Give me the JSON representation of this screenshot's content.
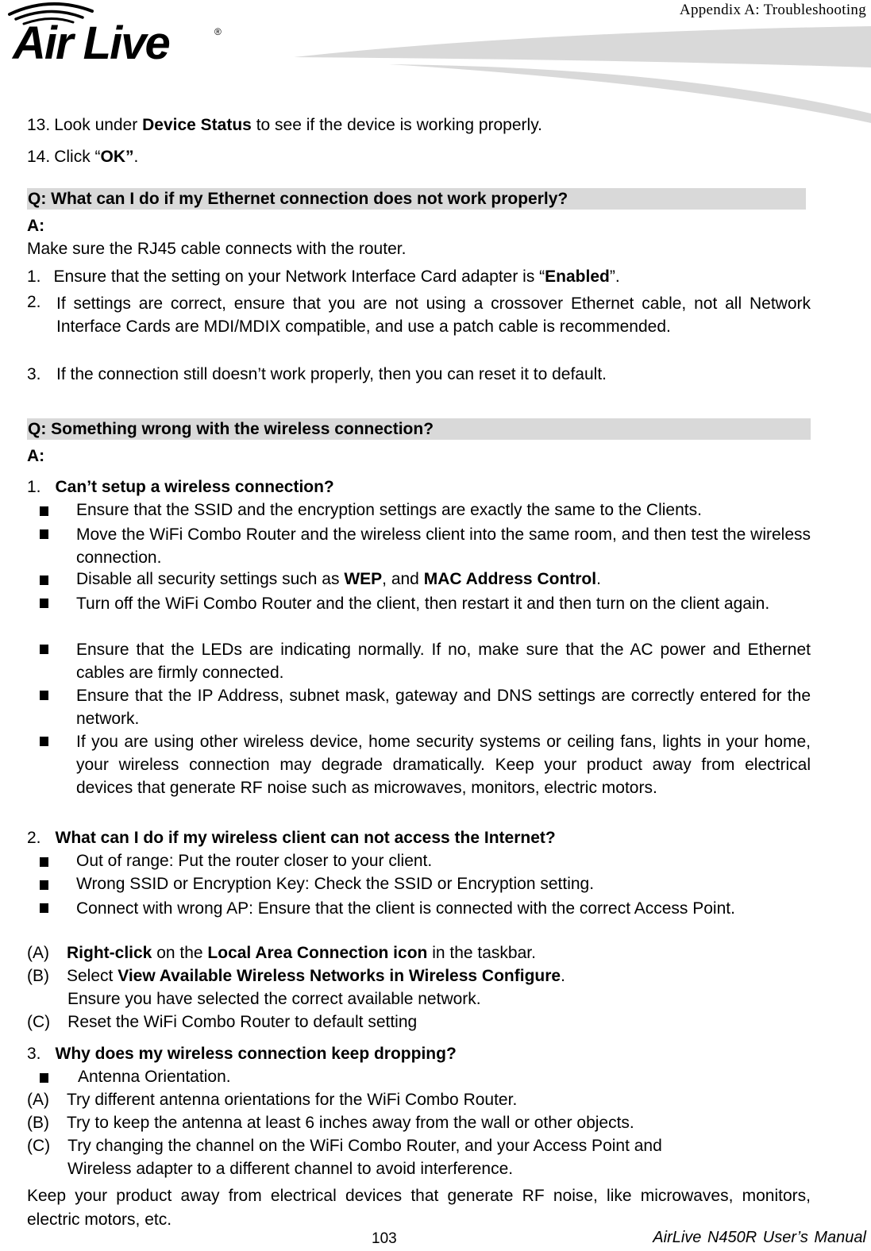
{
  "header": {
    "section_title": "Appendix  A:  Troubleshooting",
    "logo_text": "Air Live"
  },
  "steps": [
    {
      "num": "13.",
      "pre": "Look under ",
      "bold": "Device Status",
      "post": " to see if the device is working properly."
    },
    {
      "num": "14.",
      "pre": "Click “",
      "bold": "OK”",
      "post": "."
    }
  ],
  "q1": {
    "question": "Q: What can I do if my Ethernet connection does not work properly?",
    "answer_label": "A:",
    "intro": "Make sure the RJ45 cable connects with the router.",
    "items": [
      {
        "num": "1.",
        "pre": "Ensure that the setting on your Network Interface Card adapter is “",
        "bold": "Enabled",
        "post": "”."
      },
      {
        "num": "2.",
        "text": "If settings are correct, ensure that you are not using a crossover Ethernet cable, not all Network Interface Cards are MDI/MDIX compatible, and use a patch cable is recommended."
      },
      {
        "num": "3.",
        "text": "If the connection still doesn’t work properly, then you can reset it to default."
      }
    ]
  },
  "q2": {
    "question": "Q: Something wrong with the wireless connection?",
    "answer_label": "A:",
    "sub1": {
      "num": "1.",
      "title": "Can’t setup a wireless connection?",
      "bullets": [
        "Ensure that the SSID and the encryption settings are exactly the same to the Clients.",
        "Move the WiFi Combo Router and the wireless client into the same room, and then test the wireless connection.",
        {
          "pre": "Disable all security settings such as ",
          "b1": "WEP",
          "mid": ", and ",
          "b2": "MAC Address Control",
          "post": "."
        },
        "Turn off the WiFi Combo Router and the client, then restart it and then turn on the client again.",
        "Ensure that the LEDs are indicating normally. If no, make sure that the AC power and Ethernet cables are firmly connected.",
        "Ensure that the IP Address, subnet mask, gateway and DNS settings are correctly entered for the network.",
        "If you are using other wireless device, home security systems or ceiling fans, lights in your home, your wireless connection may degrade dramatically. Keep your product away from electrical devices that generate RF noise such as microwaves, monitors, electric motors."
      ]
    },
    "sub2": {
      "num": "2.",
      "title": "What can I do if my wireless client can not access the Internet?",
      "bullets": [
        "Out of range: Put the router closer to your client.",
        "Wrong SSID or Encryption Key: Check the SSID or Encryption setting.",
        "Connect with wrong AP: Ensure that the client is connected with the correct Access Point."
      ],
      "steps": [
        {
          "label": "(A)",
          "b1": "Right-click",
          "mid": " on the ",
          "b2": "Local Area Connection icon",
          "post": " in the taskbar."
        },
        {
          "label": "(B)",
          "pre": "Select ",
          "b1": "View Available Wireless Networks in Wireless Configure",
          "post": ".",
          "cont": "Ensure you have selected the correct available network."
        },
        {
          "label": "(C)",
          "text": "Reset the WiFi Combo Router to default setting"
        }
      ]
    },
    "sub3": {
      "num": "3.",
      "title": "Why does my wireless connection keep dropping?",
      "bullet": "Antenna Orientation.",
      "steps": [
        {
          "label": "(A)",
          "text": "Try different antenna orientations for the WiFi Combo Router."
        },
        {
          "label": "(B)",
          "text": "Try to keep the antenna at least 6 inches away from the wall or other objects."
        },
        {
          "label": "(C)",
          "text": "Try changing the channel on the WiFi Combo Router, and your Access Point and",
          "cont": "Wireless adapter to a different channel to avoid interference."
        }
      ]
    },
    "closing": "Keep your product away from electrical devices that generate RF noise, like microwaves, monitors, electric motors, etc."
  },
  "footer": {
    "page_number": "103",
    "manual_title": "AirLive  N450R  User’s  Manual"
  }
}
